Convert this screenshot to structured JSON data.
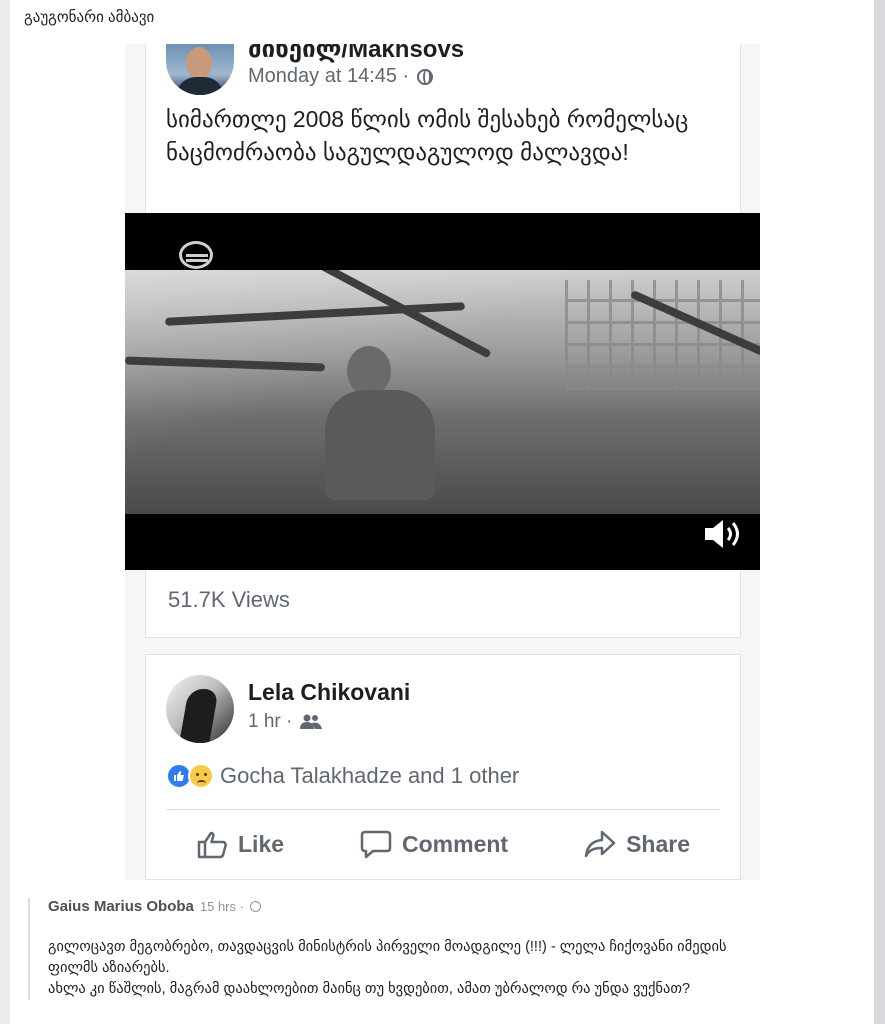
{
  "page": {
    "title": "გაუგონარი ამბავი"
  },
  "post": {
    "author": "მიხეილ/Makhsovs",
    "time": "Monday at 14:45 ·",
    "text": "სიმართლე 2008 წლის ომის შესახებ რომელსაც ნაცმოძრაობა საგულდაგულოდ მალავდა!",
    "views": "51.7K Views"
  },
  "share": {
    "author": "Lela Chikovani",
    "time": "1 hr ·",
    "reactions_text": "Gocha Talakhadze and 1 other",
    "like_label": "Like",
    "comment_label": "Comment",
    "share_label": "Share"
  },
  "comment": {
    "author": "Gaius Marius Oboba",
    "time": "15 hrs ·",
    "line1": "გილოცავთ მეგობრებო, თავდაცვის მინისტრის პირველი მოადგილე (!!!) - ლელა ჩიქოვანი იმედის",
    "line2": "ფილმს აზიარებს.",
    "line3": "ახლა კი წაშლის, მაგრამ დაახლოებით მაინც თუ ხვდებით, ამათ უბრალოდ რა უნდა ვუქნათ?"
  },
  "icons": {
    "globe": "globe-icon",
    "friends": "friends-icon",
    "volume": "volume-icon",
    "like": "thumbs-up-icon",
    "comment": "comment-bubble-icon",
    "share": "share-arrow-icon"
  },
  "colors": {
    "facebook_blue": "#2f7bf2",
    "text_gray": "#606770"
  }
}
